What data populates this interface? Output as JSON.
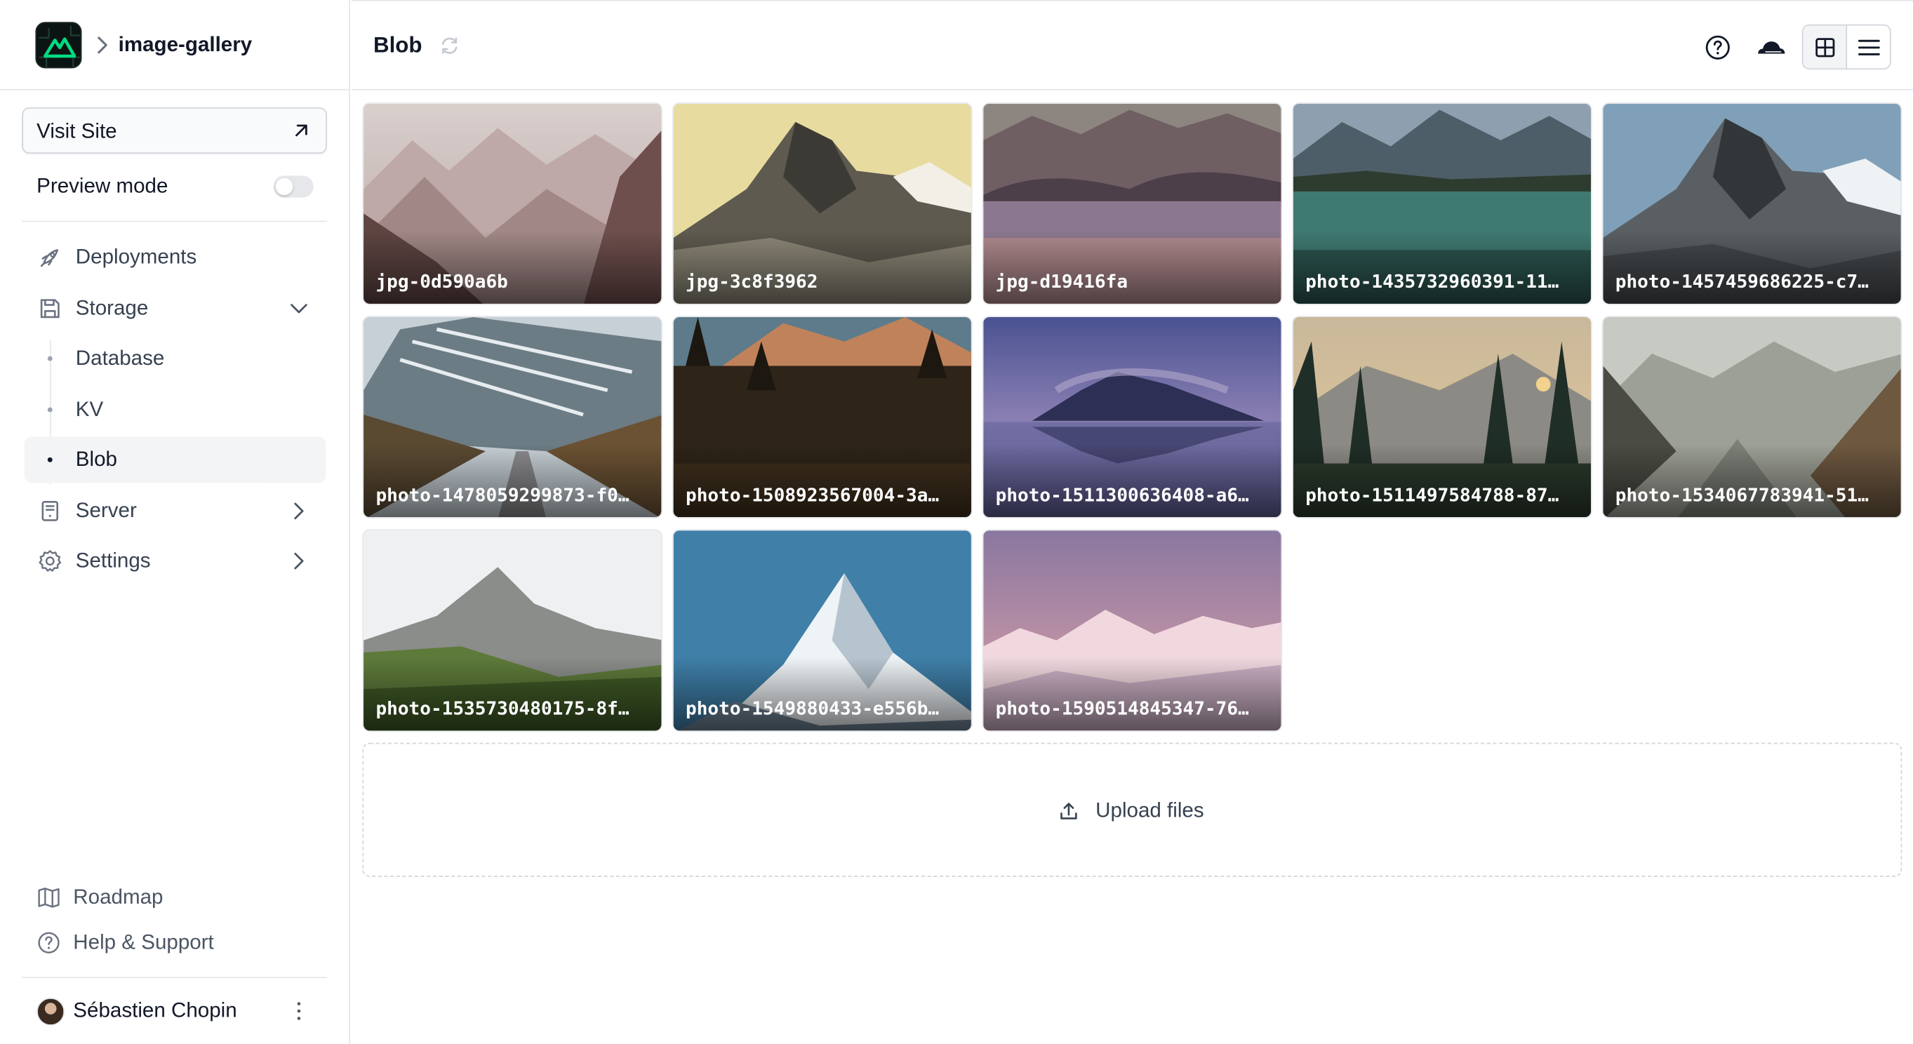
{
  "sidebar": {
    "project_name": "image-gallery",
    "visit_site_label": "Visit Site",
    "preview_mode_label": "Preview mode",
    "preview_mode_on": false,
    "nav": {
      "deployments": "Deployments",
      "storage": "Storage",
      "database": "Database",
      "kv": "KV",
      "blob": "Blob",
      "server": "Server",
      "settings": "Settings"
    },
    "footer_links": {
      "roadmap": "Roadmap",
      "help": "Help & Support"
    },
    "user": {
      "name": "Sébastien Chopin"
    }
  },
  "header": {
    "title": "Blob",
    "view_mode": "grid"
  },
  "gallery": {
    "items": [
      {
        "name": "jpg-0d590a6b",
        "scene": "misty peaks"
      },
      {
        "name": "jpg-3c8f3962",
        "scene": "golden rocky peak"
      },
      {
        "name": "jpg-d19416fa",
        "scene": "lake with trees"
      },
      {
        "name": "photo-1435732960391-11…",
        "scene": "turquoise lake"
      },
      {
        "name": "photo-1457459686225-c7…",
        "scene": "rocky peak"
      },
      {
        "name": "photo-1478059299873-f0…",
        "scene": "mountain road"
      },
      {
        "name": "photo-1508923567004-3a…",
        "scene": "forest at sunset"
      },
      {
        "name": "photo-1511300636408-a6…",
        "scene": "purple reflection"
      },
      {
        "name": "photo-1511497584788-87…",
        "scene": "pine forest"
      },
      {
        "name": "photo-1534067783941-51…",
        "scene": "foggy valley"
      },
      {
        "name": "photo-1535730480175-8f…",
        "scene": "green valley"
      },
      {
        "name": "photo-1549880433-e556b…",
        "scene": "snowy peak blue sky"
      },
      {
        "name": "photo-1590514845347-76…",
        "scene": "pink snowy range"
      }
    ],
    "upload_label": "Upload files"
  },
  "colors": {
    "brand_green": "#00dc82",
    "active_bg": "#f3f4f6",
    "border": "#e5e7eb"
  }
}
